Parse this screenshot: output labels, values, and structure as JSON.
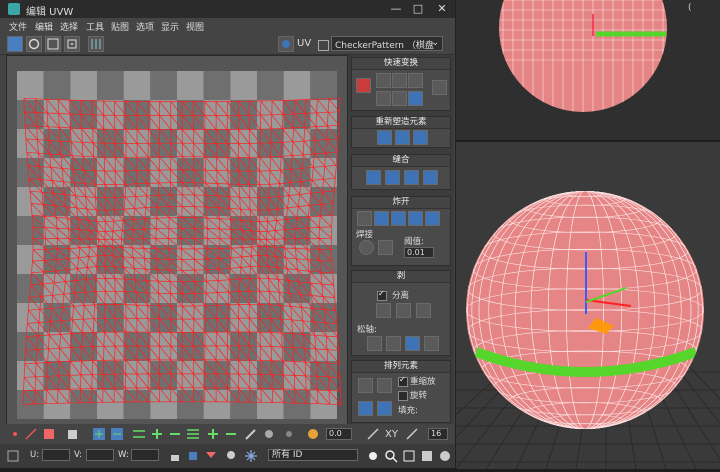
{
  "window": {
    "title": "编辑 UVW",
    "min": "—",
    "max": "□",
    "close": "✕"
  },
  "menu": [
    "文件",
    "编辑",
    "选择",
    "工具",
    "贴图",
    "选项",
    "显示",
    "视图"
  ],
  "toolbar": {
    "uv_label": "UV",
    "texture_dropdown": "CheckerPattern （棋盘"
  },
  "panel": {
    "quick_transform": "快速变换",
    "reshape_elements": "重新塑造元素",
    "stitch": "缝合",
    "explode": "炸开",
    "weld": "焊接",
    "threshold_label": "阈值:",
    "threshold_value": "0.01",
    "peel": "剥",
    "detach": "分离",
    "pins": "松轴:",
    "arrange_elements": "排列元素",
    "rescale": "重缩放",
    "rotate": "旋转",
    "padding": "填充:"
  },
  "bottom": {
    "value1": "0.0",
    "xy": "XY",
    "value2": "16",
    "u_label": "U:",
    "v_label": "V:",
    "w_label": "W:",
    "select_mode": "所有 ID"
  },
  "colors": {
    "mesh": "#ff2020",
    "sphere": "#e58585",
    "seam": "#56d62a",
    "accent_blue": "#3f73b8"
  }
}
